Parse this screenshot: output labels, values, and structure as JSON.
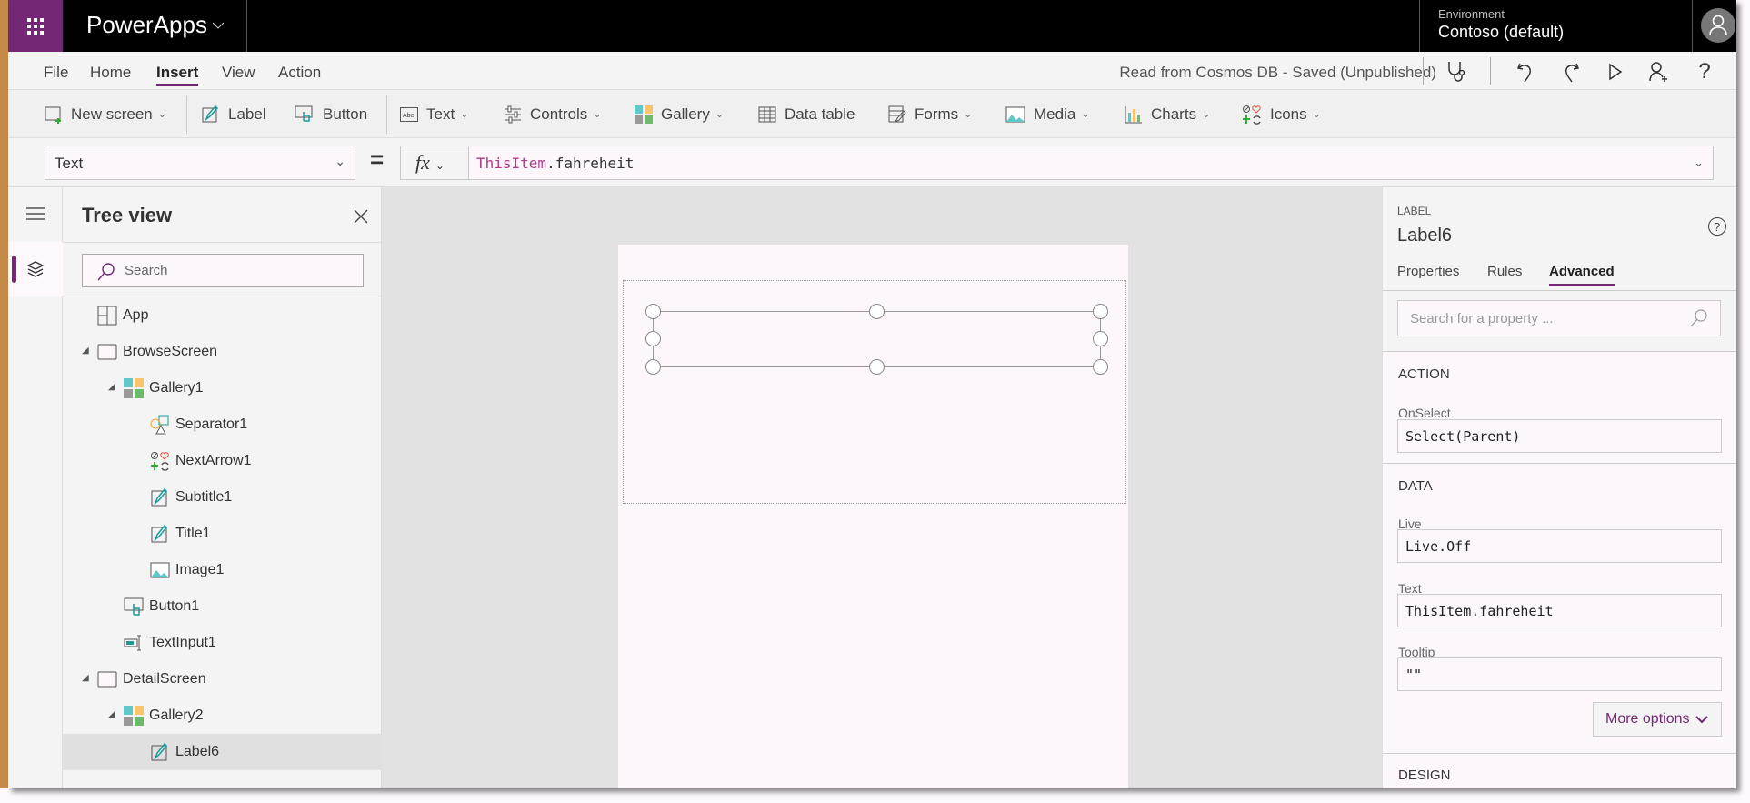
{
  "app": {
    "title": "PowerApps",
    "environment_label": "Environment",
    "environment_value": "Contoso (default)"
  },
  "menu": {
    "items": [
      "File",
      "Home",
      "Insert",
      "View",
      "Action"
    ],
    "active": "Insert",
    "status": "Read from Cosmos DB - Saved (Unpublished)"
  },
  "ribbon": {
    "new_screen": "New screen",
    "label": "Label",
    "button": "Button",
    "text": "Text",
    "controls": "Controls",
    "gallery": "Gallery",
    "data_table": "Data table",
    "forms": "Forms",
    "media": "Media",
    "charts": "Charts",
    "icons": "Icons"
  },
  "formula": {
    "property": "Text",
    "equals": "=",
    "fx": "fx",
    "expr_keyword": "ThisItem",
    "expr_rest": ".fahreheit"
  },
  "tree": {
    "title": "Tree view",
    "search_placeholder": "Search",
    "items": [
      {
        "label": "App",
        "icon": "app-icon"
      },
      {
        "label": "BrowseScreen",
        "icon": "screen-icon"
      },
      {
        "label": "Gallery1",
        "icon": "gallery-icon"
      },
      {
        "label": "Separator1",
        "icon": "shapes-icon"
      },
      {
        "label": "NextArrow1",
        "icon": "icons-icon"
      },
      {
        "label": "Subtitle1",
        "icon": "label-icon"
      },
      {
        "label": "Title1",
        "icon": "label-icon"
      },
      {
        "label": "Image1",
        "icon": "image-icon"
      },
      {
        "label": "Button1",
        "icon": "button-icon"
      },
      {
        "label": "TextInput1",
        "icon": "text-input-icon"
      },
      {
        "label": "DetailScreen",
        "icon": "screen-icon"
      },
      {
        "label": "Gallery2",
        "icon": "gallery-icon"
      },
      {
        "label": "Label6",
        "icon": "label-icon"
      }
    ],
    "selected": "Label6"
  },
  "props": {
    "type": "LABEL",
    "name": "Label6",
    "tabs": [
      "Properties",
      "Rules",
      "Advanced"
    ],
    "active_tab": "Advanced",
    "search_placeholder": "Search for a property ...",
    "action_header": "ACTION",
    "onselect_label": "OnSelect",
    "onselect_value": "Select(Parent)",
    "data_header": "DATA",
    "live_label": "Live",
    "live_value": "Live.Off",
    "text_label": "Text",
    "text_value": "ThisItem.fahreheit",
    "tooltip_label": "Tooltip",
    "tooltip_value": "\"\"",
    "more_options": "More options",
    "design_header": "DESIGN"
  },
  "colors": {
    "accent": "#742774",
    "strip": "#c68a48"
  }
}
